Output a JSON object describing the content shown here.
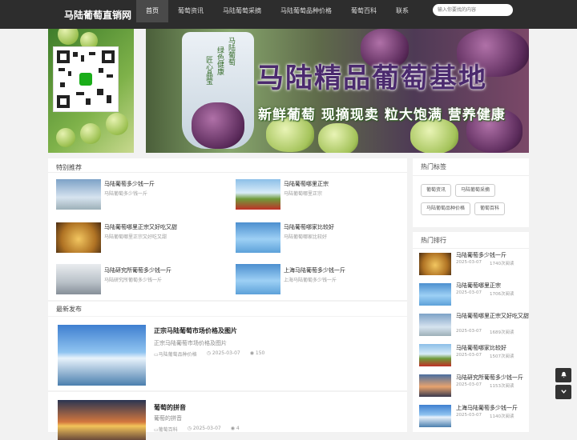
{
  "header": {
    "logo": "马陆葡萄直销网",
    "nav": [
      "首页",
      "葡萄资讯",
      "马陆葡萄采摘",
      "马陆葡萄品种价格",
      "葡萄百科",
      "联系"
    ],
    "search_placeholder": "输入你要找的内容"
  },
  "banner": {
    "title": "马陆精品葡萄基地",
    "subtitle": "新鲜葡萄 现摘现卖 粒大饱满 营养健康",
    "bag_text": [
      "马陆葡萄",
      "绿色健康",
      "匠心晶莹"
    ]
  },
  "featured": {
    "heading": "特别推荐",
    "items": [
      {
        "title": "马陆葡萄多少钱一斤",
        "sub": "马陆葡萄多少钱一斤"
      },
      {
        "title": "马陆葡萄哪里正宗",
        "sub": "马陆葡萄哪里正宗"
      },
      {
        "title": "马陆葡萄哪里正宗又好吃又甜",
        "sub": "马陆葡萄哪里正宗又好吃又甜"
      },
      {
        "title": "马陆葡萄哪家比较好",
        "sub": "马陆葡萄哪家比较好"
      },
      {
        "title": "马陆研究所葡萄多少钱一斤",
        "sub": "马陆研究所葡萄多少钱一斤"
      },
      {
        "title": "上海马陆葡萄多少钱一斤",
        "sub": "上海马陆葡萄多少钱一斤"
      }
    ]
  },
  "latest": {
    "heading": "最新发布",
    "items": [
      {
        "title": "正宗马陆葡萄市场价格及图片",
        "desc": "正宗马陆葡萄市场价格及图片",
        "category": "马陆葡萄品种价格",
        "date": "2025-03-07",
        "views": "150"
      },
      {
        "title": "葡萄的拼音",
        "desc": "葡萄的拼音",
        "category": "葡萄百科",
        "date": "2025-03-07",
        "views": "4"
      }
    ]
  },
  "hot_tags": {
    "heading": "热门标签",
    "tags": [
      "葡萄资讯",
      "马陆葡萄采摘",
      "马陆葡萄品种价格",
      "葡萄百科"
    ]
  },
  "hot_rank": {
    "heading": "热门排行",
    "items": [
      {
        "title": "马陆葡萄多少钱一斤",
        "date": "2025-03-07",
        "views": "1740次阅读"
      },
      {
        "title": "马陆葡萄哪里正宗",
        "date": "2025-03-07",
        "views": "1706次阅读"
      },
      {
        "title": "马陆葡萄哪里正宗又好吃又甜",
        "date": "2025-03-07",
        "views": "1689次阅读"
      },
      {
        "title": "马陆葡萄哪家比较好",
        "date": "2025-03-07",
        "views": "1507次阅读"
      },
      {
        "title": "马陆研究所葡萄多少钱一斤",
        "date": "2025-03-07",
        "views": "1153次阅读"
      },
      {
        "title": "上海马陆葡萄多少钱一斤",
        "date": "2025-03-07",
        "views": "1140次阅读"
      }
    ]
  },
  "float_buttons": [
    "bell-icon",
    "chevron-down-icon"
  ]
}
